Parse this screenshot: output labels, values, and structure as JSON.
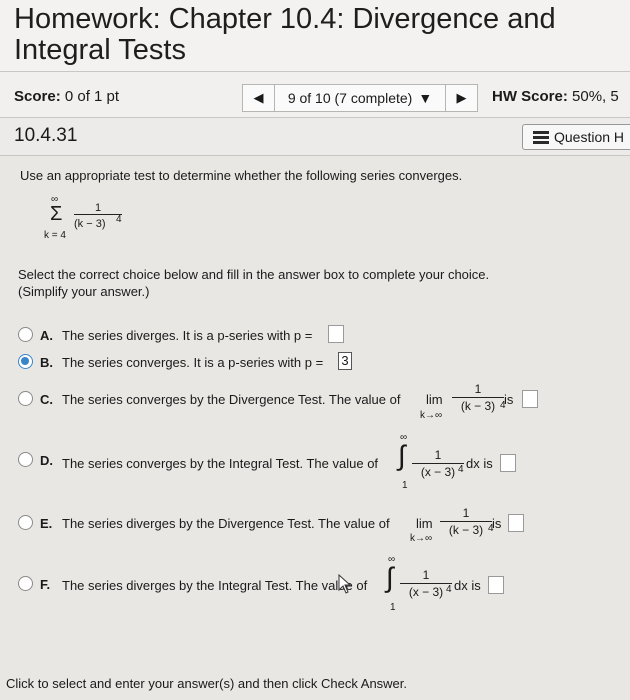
{
  "header": {
    "title": "Homework: Chapter 10.4: Divergence and\nIntegral Tests"
  },
  "score_bar": {
    "score_label": "Score:",
    "score_value": "0 of 1 pt",
    "nav_prev": "◀",
    "nav_select": "9 of 10 (7 complete)",
    "nav_select_caret": "▼",
    "nav_next": "▶",
    "hw_label": "HW Score:",
    "hw_value": "50%, 5"
  },
  "question_bar": {
    "number": "10.4.31",
    "help_label": "Question H"
  },
  "question": {
    "prompt": "Use an appropriate test to determine whether the following series converges.",
    "series": {
      "sigma": "Σ",
      "upper": "∞",
      "lower": "k = 4",
      "numerator": "1",
      "denominator": "(k − 3)",
      "exponent": "4"
    },
    "instructions": "Select the correct choice below and fill in the answer box to complete your choice.\n(Simplify your answer.)"
  },
  "choices": [
    {
      "letter": "A.",
      "text": "The series diverges. It is a p-series with p =",
      "answer": "",
      "selected": false
    },
    {
      "letter": "B.",
      "text": "The series converges. It is a p-series with p =",
      "answer": "3",
      "selected": true
    },
    {
      "letter": "C.",
      "text": "The series converges by the Divergence Test. The value of",
      "lim": "lim",
      "lim_sub": "k→∞",
      "num": "1",
      "den": "(k − 3)",
      "exp": "4",
      "tail": "is",
      "answer": "",
      "selected": false
    },
    {
      "letter": "D.",
      "text": "The series converges by the Integral Test. The value of",
      "int_upper": "∞",
      "int_lower": "1",
      "num": "1",
      "den": "(x − 3)",
      "exp": "4",
      "tail": "dx is",
      "answer": "",
      "selected": false
    },
    {
      "letter": "E.",
      "text": "The series diverges by the Divergence Test. The value of",
      "lim": "lim",
      "lim_sub": "k→∞",
      "num": "1",
      "den": "(k − 3)",
      "exp": "4",
      "tail": "is",
      "answer": "",
      "selected": false
    },
    {
      "letter": "F.",
      "text": "The series diverges by the Integral Test. The value of",
      "int_upper": "∞",
      "int_lower": "1",
      "num": "1",
      "den": "(x − 3)",
      "exp": "4",
      "tail": "dx is",
      "answer": "",
      "selected": false
    }
  ],
  "footer": {
    "text": "Click to select and enter your answer(s) and then click Check Answer."
  },
  "colors": {
    "accent": "#3a84c8"
  }
}
